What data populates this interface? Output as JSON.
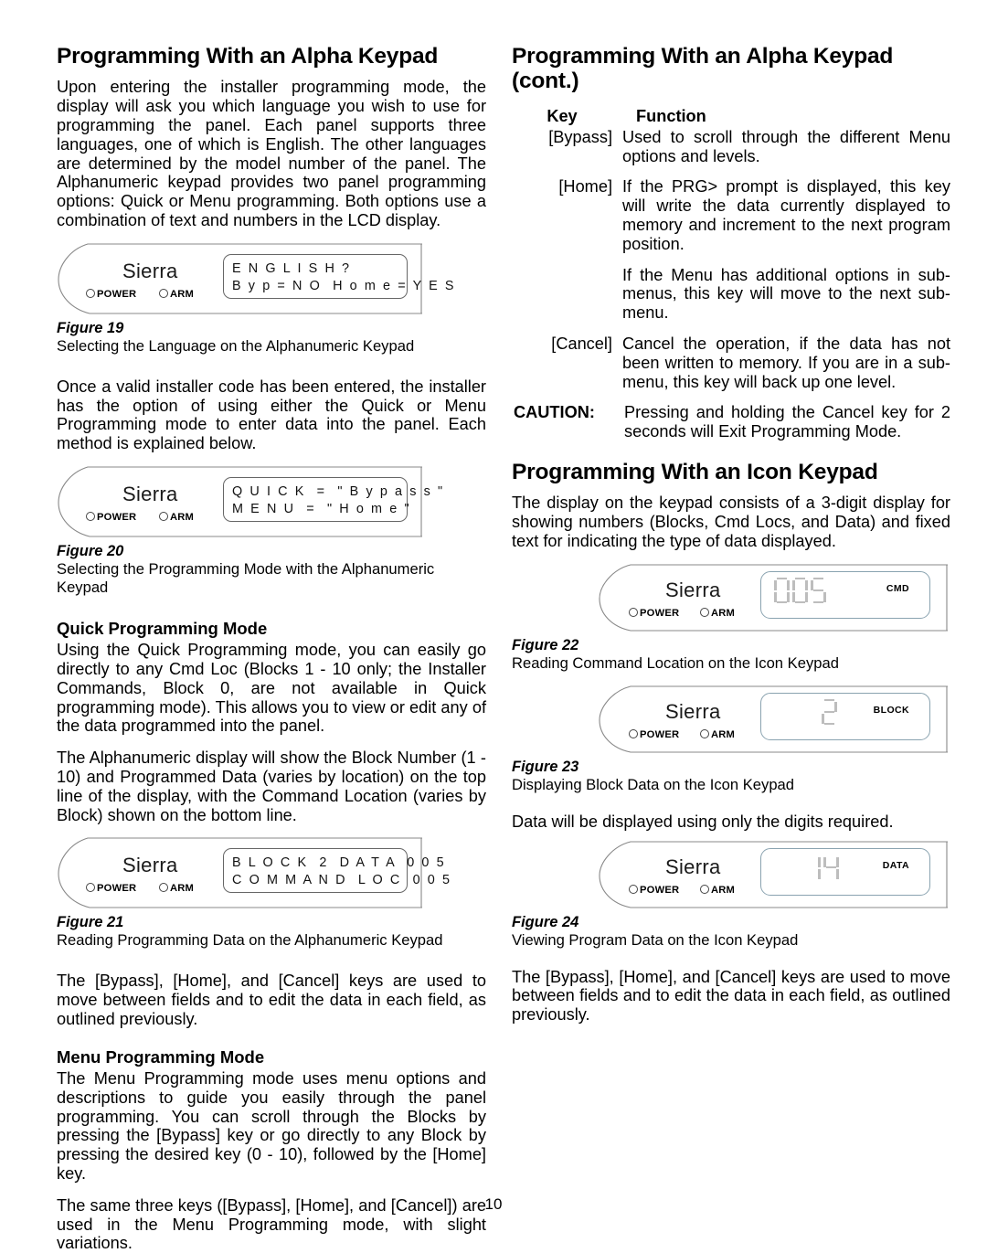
{
  "page_number": "10",
  "left_column": {
    "heading": "Programming With an Alpha Keypad",
    "para_intro": "Upon entering the installer programming mode, the display will ask you which language you wish to use for programming the panel. Each panel supports three languages, one of which is English. The other languages are determined by the model number of the panel. The Alphanumeric keypad provides two panel programming options: Quick or Menu programming. Both options use a combination of text and numbers in the LCD display.",
    "figure19": {
      "brand": "Sierra",
      "led_power": "POWER",
      "led_arm": "ARM",
      "lcd_line1": "E N G L I S H ?",
      "lcd_line2": "B y p = N O  H o m e = Y E S",
      "caption_number": "Figure  19",
      "caption_text": "Selecting the Language on the Alphanumeric Keypad"
    },
    "para_after_fig19": "Once a valid installer code has been entered, the installer has the option of using either the Quick or Menu Programming mode to enter data into the panel. Each method is explained below.",
    "figure20": {
      "brand": "Sierra",
      "led_power": "POWER",
      "led_arm": "ARM",
      "lcd_line1": "Q U I C K  =  \" B y p a s s \"",
      "lcd_line2": "M E N U  =  \" H o m e \"",
      "caption_number": "Figure  20",
      "caption_text": "Selecting the Programming Mode with the Alphanumeric Keypad"
    },
    "quick_heading": "Quick Programming Mode",
    "quick_para1": "Using the Quick Programming mode, you can easily go directly to any Cmd Loc (Blocks 1 - 10 only; the Installer Commands, Block 0, are not available in Quick programming mode). This allows you to view or edit any of the data programmed into the panel.",
    "quick_para2": "The Alphanumeric display will show the Block Number (1 - 10) and Programmed Data (varies by location) on the top line of the display, with the Command Location (varies by Block) shown on the bottom line.",
    "figure21": {
      "brand": "Sierra",
      "led_power": "POWER",
      "led_arm": "ARM",
      "lcd_line1": "B L O C K  2  D A T A  0 0 5",
      "lcd_line2": "C O M M A N D  L O C  0 0 5",
      "caption_number": "Figure  21",
      "caption_text": "Reading Programming Data on the Alphanumeric Keypad"
    },
    "para_keys": "The [Bypass], [Home], and [Cancel] keys are used to move between fields and to edit the data in each field, as outlined previously.",
    "menu_heading": "Menu Programming Mode",
    "menu_para1": "The Menu Programming mode uses menu options and descriptions to guide you easily through the panel programming. You can scroll through the Blocks by pressing the [Bypass] key or go directly to any Block by pressing the desired key (0 - 10), followed by the [Home] key.",
    "menu_para2": "The same three keys ([Bypass], [Home], and [Cancel]) are used in the Menu Programming mode, with slight variations."
  },
  "right_column": {
    "heading": "Programming With an Alpha Keypad (cont.)",
    "table_header_key": "Key",
    "table_header_function": "Function",
    "rows": [
      {
        "key": "[Bypass]",
        "paras": [
          "Used to scroll through the different Menu options and levels."
        ]
      },
      {
        "key": "[Home]",
        "paras": [
          "If the PRG> prompt is displayed, this key will write the data currently displayed to memory and increment to the next program position.",
          "If the Menu has additional options in sub-menus, this key will move to the next sub-menu."
        ]
      },
      {
        "key": "[Cancel]",
        "paras": [
          "Cancel the operation, if the data has not been written to memory. If you are in a sub-menu, this key will back up one level."
        ]
      }
    ],
    "caution_label": "CAUTION:",
    "caution_text": "Pressing and holding the Cancel key for 2 seconds will Exit Programming Mode.",
    "icon_heading": "Programming With an Icon Keypad",
    "icon_para1": "The display on the keypad consists of a 3-digit display for showing numbers (Blocks, Cmd Locs, and Data) and fixed text for indicating the type of data displayed.",
    "figure22": {
      "brand": "Sierra",
      "led_power": "POWER",
      "led_arm": "ARM",
      "digits": "005",
      "mode_label": "CMD",
      "caption_number": "Figure  22",
      "caption_text": "Reading Command Location on the Icon Keypad"
    },
    "figure23": {
      "brand": "Sierra",
      "led_power": "POWER",
      "led_arm": "ARM",
      "digits": "2",
      "mode_label": "BLOCK",
      "caption_number": "Figure  23",
      "caption_text": "Displaying Block Data on the Icon Keypad"
    },
    "para_digits": "Data will be displayed using only the digits required.",
    "figure24": {
      "brand": "Sierra",
      "led_power": "POWER",
      "led_arm": "ARM",
      "digits": "14",
      "mode_label": "DATA",
      "caption_number": "Figure  24",
      "caption_text": "Viewing Program Data on the Icon Keypad"
    },
    "para_keys": "The [Bypass], [Home], and [Cancel] keys are used to move between fields and to edit the data in each field, as outlined previously."
  }
}
